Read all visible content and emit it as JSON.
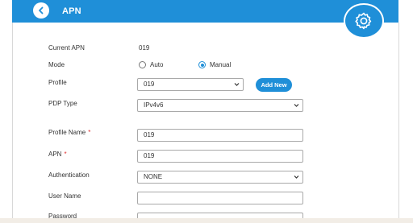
{
  "header": {
    "title": "APN",
    "back_icon": "chevron-left-icon",
    "settings_icon": "gear-icon",
    "color": "#1f8fd8"
  },
  "form": {
    "current_apn": {
      "label": "Current APN",
      "value": "019"
    },
    "mode": {
      "label": "Mode",
      "options": [
        {
          "label": "Auto",
          "selected": false
        },
        {
          "label": "Manual",
          "selected": true
        }
      ]
    },
    "profile": {
      "label": "Profile",
      "selected": "019",
      "add_button": "Add New"
    },
    "pdp_type": {
      "label": "PDP Type",
      "selected": "IPv4v6"
    },
    "profile_name": {
      "label": "Profile Name",
      "required_mark": "*",
      "value": "019"
    },
    "apn": {
      "label": "APN",
      "required_mark": "*",
      "value": "019"
    },
    "authentication": {
      "label": "Authentication",
      "selected": "NONE"
    },
    "user_name": {
      "label": "User Name",
      "value": ""
    },
    "password": {
      "label": "Password",
      "value": ""
    }
  }
}
